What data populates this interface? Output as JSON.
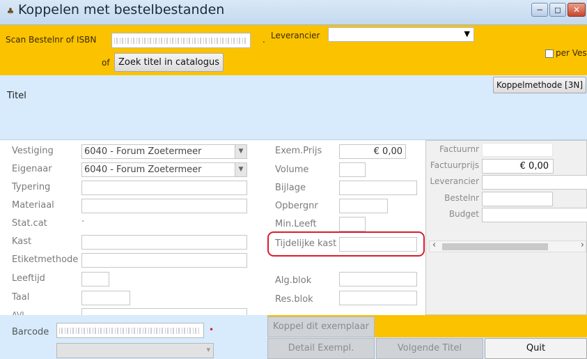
{
  "window": {
    "title": "Koppelen met bestelbestanden",
    "icon": "app-icon",
    "minimize": "−",
    "maximize": "◻",
    "close": "✕"
  },
  "toolbar": {
    "scan_label": "Scan Bestelnr of ISBN",
    "scan_value": "",
    "leverancier_label": "Leverancier",
    "leverancier_value": "",
    "of_label": "of",
    "zoek_button": "Zoek titel in catalogus",
    "per_vest_label": "per Vest.",
    "per_vest_checked": false
  },
  "titel": {
    "label": "Titel",
    "koppelmethode_button": "Koppelmethode [3N]"
  },
  "form": {
    "left": [
      {
        "label": "Vestiging",
        "value": "6040 - Forum Zoetermeer",
        "type": "combo"
      },
      {
        "label": "Eigenaar",
        "value": "6040 - Forum Zoetermeer",
        "type": "combo"
      },
      {
        "label": "Typering",
        "value": "",
        "type": "text"
      },
      {
        "label": "Materiaal",
        "value": "",
        "type": "text"
      },
      {
        "label": "Stat.cat",
        "value": "",
        "type": "none"
      },
      {
        "label": "Kast",
        "value": "",
        "type": "text"
      },
      {
        "label": "Etiketmethode",
        "value": "",
        "type": "text"
      },
      {
        "label": "Leeftijd",
        "value": "",
        "type": "small"
      },
      {
        "label": "Taal",
        "value": "",
        "type": "small"
      },
      {
        "label": "AVI",
        "value": "",
        "type": "text"
      }
    ],
    "middle": [
      {
        "label": "Exem.Prijs",
        "value": "€ 0,00"
      },
      {
        "label": "Volume",
        "value": ""
      },
      {
        "label": "Bijlage",
        "value": ""
      },
      {
        "label": "Opbergnr",
        "value": ""
      },
      {
        "label": "Min.Leeft",
        "value": ""
      },
      {
        "label": "Tijdelijke kast",
        "value": ""
      },
      {
        "label": "Alg.blok",
        "value": ""
      },
      {
        "label": "Res.blok",
        "value": ""
      }
    ],
    "highlight_color": "#d81c2c"
  },
  "right": {
    "rows": [
      {
        "label": "Factuurnr",
        "value": ""
      },
      {
        "label": "Factuurprijs",
        "value": "€ 0,00"
      },
      {
        "label": "Leverancier",
        "value": ""
      },
      {
        "label": "Bestelnr",
        "value": ""
      },
      {
        "label": "Budget",
        "value": ""
      }
    ],
    "scroll_left": "‹",
    "scroll_right": "›"
  },
  "bottom": {
    "barcode_label": "Barcode",
    "barcode_value": "",
    "koppel_button": "Koppel dit exemplaar",
    "detail_button": "Detail Exempl.",
    "volgende_button": "Volgende Titel",
    "quit_button": "Quit"
  },
  "colors": {
    "toolbar": "#fbc200",
    "panel": "#d7ebfd",
    "accent": "#fbc200"
  }
}
